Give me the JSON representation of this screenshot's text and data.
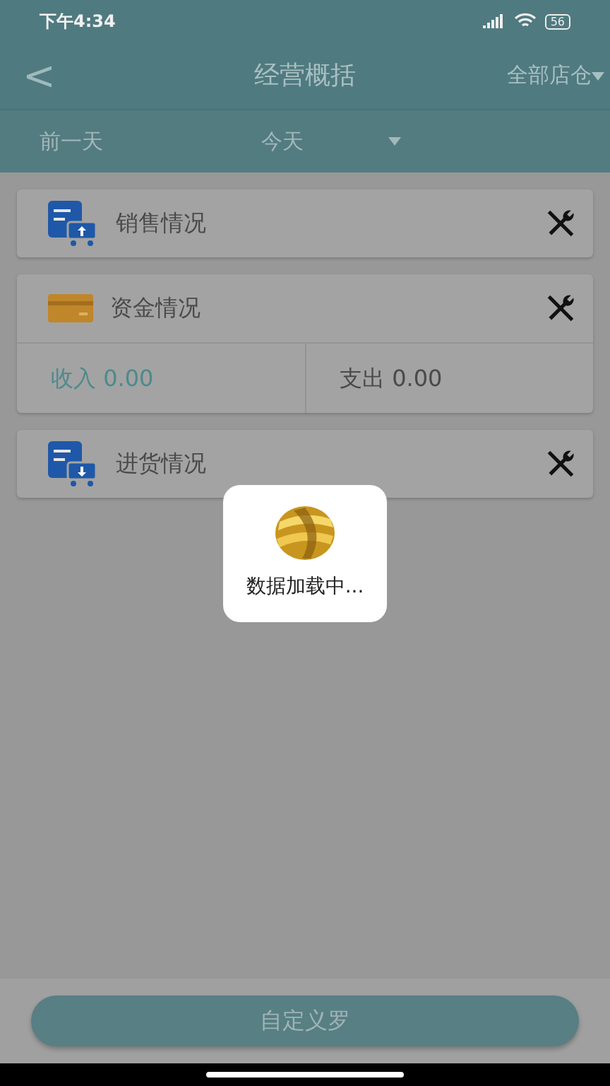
{
  "status_bar": {
    "time": "下午4:34",
    "battery": "56"
  },
  "nav": {
    "back": "<",
    "title": "经营概括",
    "store_filter": "全部店仓"
  },
  "date_bar": {
    "previous": "前一天",
    "current": "今天"
  },
  "sections": [
    {
      "kind": "sales",
      "title": "销售情况"
    },
    {
      "kind": "funds",
      "title": "资金情况",
      "income": "收入 0.00",
      "expense": "支出 0.00"
    },
    {
      "kind": "purchase",
      "title": "进货情况"
    }
  ],
  "loading": {
    "text": "数据加载中..."
  },
  "bottom_button": {
    "label": "自定义罗"
  }
}
